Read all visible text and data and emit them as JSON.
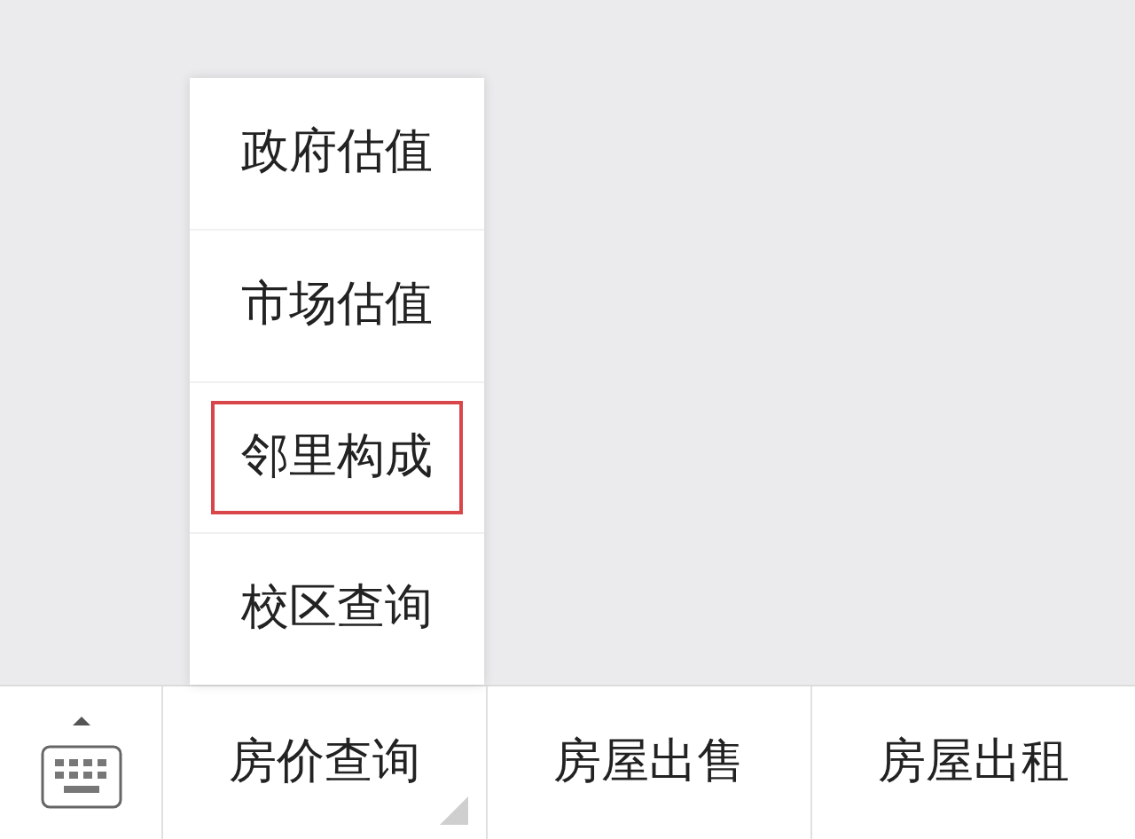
{
  "popup_menu": {
    "items": [
      {
        "label": "政府估值",
        "selected": false
      },
      {
        "label": "市场估值",
        "selected": false
      },
      {
        "label": "邻里构成",
        "selected": true
      },
      {
        "label": "校区查询",
        "selected": false
      }
    ]
  },
  "bottom_menu": {
    "tabs": [
      {
        "label": "房价查询",
        "has_submenu": true
      },
      {
        "label": "房屋出售",
        "has_submenu": false
      },
      {
        "label": "房屋出租",
        "has_submenu": false
      }
    ]
  }
}
